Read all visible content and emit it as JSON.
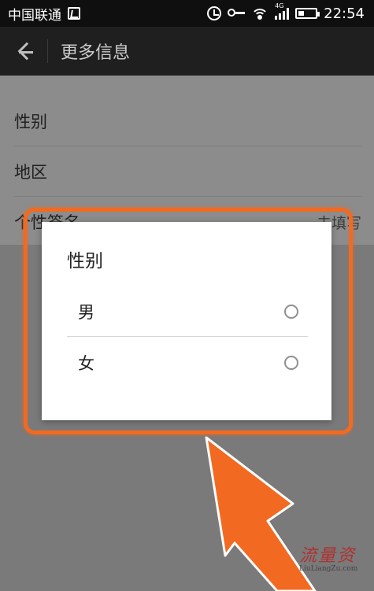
{
  "status_bar": {
    "carrier": "中国联通",
    "network": "4G",
    "time": "22:54"
  },
  "app_bar": {
    "title": "更多信息"
  },
  "settings": {
    "items": [
      {
        "label": "性别",
        "hint": ""
      },
      {
        "label": "地区",
        "hint": ""
      },
      {
        "label": "个性签名",
        "hint": "未填写"
      }
    ]
  },
  "dialog": {
    "title": "性别",
    "options": [
      {
        "label": "男",
        "selected": false
      },
      {
        "label": "女",
        "selected": false
      }
    ]
  },
  "highlight_color": "#f26a21",
  "watermark": {
    "main": "流量资",
    "sub": "LiuLiangZu.com"
  }
}
